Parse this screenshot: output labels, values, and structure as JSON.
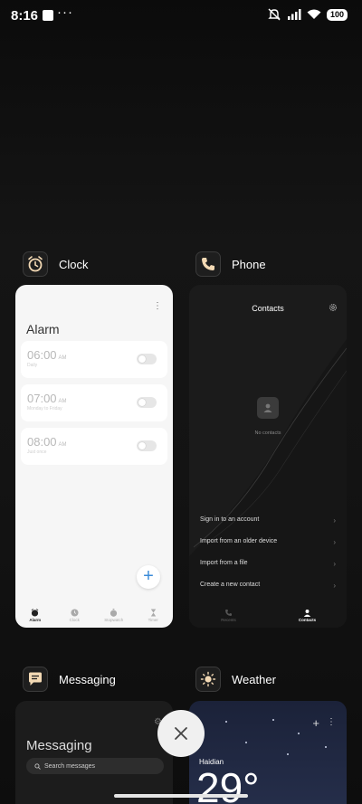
{
  "status": {
    "time": "8:16",
    "dots": "···",
    "battery": "100"
  },
  "apps": {
    "clock": {
      "name": "Clock",
      "title": "Alarm",
      "alarms": [
        {
          "time": "06:00",
          "ampm": "AM",
          "sub": "Daily"
        },
        {
          "time": "07:00",
          "ampm": "AM",
          "sub": "Monday to Friday"
        },
        {
          "time": "08:00",
          "ampm": "AM",
          "sub": "Just once"
        }
      ],
      "fab": "+",
      "nav": [
        "Alarm",
        "Clock",
        "Stopwatch",
        "Timer"
      ]
    },
    "phone": {
      "name": "Phone",
      "title": "Contacts",
      "empty": "No contacts",
      "options": [
        "Sign in to an account",
        "Import from an older device",
        "Import from a file",
        "Create a new contact"
      ],
      "nav": [
        "Recents",
        "Contacts"
      ]
    },
    "messaging": {
      "name": "Messaging",
      "title": "Messaging",
      "search_placeholder": "Search messages"
    },
    "weather": {
      "name": "Weather",
      "location": "Haidian",
      "temp": "29°"
    }
  },
  "colors": {
    "accent": "#3a8bd8",
    "background": "#111111"
  }
}
